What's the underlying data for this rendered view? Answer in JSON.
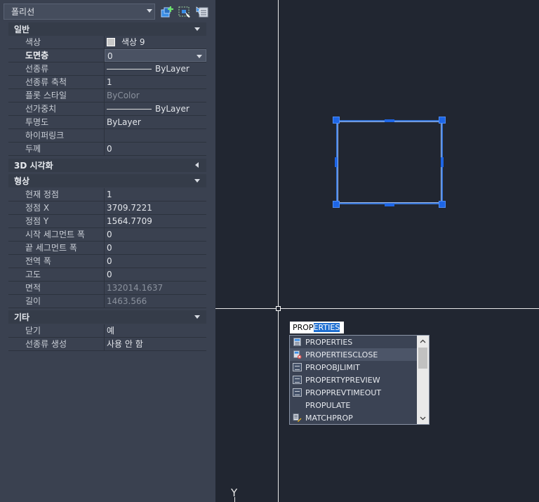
{
  "palette": {
    "object_type": "폴리선",
    "sections": {
      "general": "일반",
      "visual3d": "3D 시각화",
      "geometry": "형상",
      "misc": "기타"
    },
    "general_rows": [
      {
        "label": "색상",
        "value": "색상 9"
      },
      {
        "label": "도면층",
        "value": "0"
      },
      {
        "label": "선종류",
        "value": "ByLayer"
      },
      {
        "label": "선종류 축척",
        "value": "1"
      },
      {
        "label": "플롯 스타일",
        "value": "ByColor"
      },
      {
        "label": "선가중치",
        "value": "ByLayer"
      },
      {
        "label": "투명도",
        "value": "ByLayer"
      },
      {
        "label": "하이퍼링크",
        "value": ""
      },
      {
        "label": "두께",
        "value": "0"
      }
    ],
    "geometry_rows": [
      {
        "label": "현재 정점",
        "value": "1"
      },
      {
        "label": "정점 X",
        "value": "3709.7221"
      },
      {
        "label": "정점 Y",
        "value": "1564.7709"
      },
      {
        "label": "시작 세그먼트 폭",
        "value": "0"
      },
      {
        "label": "끝 세그먼트 폭",
        "value": "0"
      },
      {
        "label": "전역 폭",
        "value": "0"
      },
      {
        "label": "고도",
        "value": "0"
      },
      {
        "label": "면적",
        "value": "132014.1637"
      },
      {
        "label": "길이",
        "value": "1463.566"
      }
    ],
    "misc_rows": [
      {
        "label": "닫기",
        "value": "예"
      },
      {
        "label": "선종류 생성",
        "value": "사용 안 함"
      }
    ]
  },
  "command": {
    "typed": "PROP",
    "completion": "ERTIES",
    "suggestions": [
      {
        "label": "PROPERTIES",
        "icon": "properties-icon"
      },
      {
        "label": "PROPERTIESCLOSE",
        "icon": "properties-close-icon"
      },
      {
        "label": "PROPOBJLIMIT",
        "icon": "system-variable-icon"
      },
      {
        "label": "PROPERTYPREVIEW",
        "icon": "system-variable-icon"
      },
      {
        "label": "PROPPREVTIMEOUT",
        "icon": "system-variable-icon"
      },
      {
        "label": "PROPULATE",
        "icon": ""
      },
      {
        "label": "MATCHPROP",
        "icon": "match-properties-icon"
      }
    ]
  },
  "ucs": {
    "y_label": "Y"
  },
  "colors": {
    "grip": "#1e66e6",
    "selection": "#3b78d8",
    "canvas": "#212631",
    "palette": "#3a4150"
  }
}
